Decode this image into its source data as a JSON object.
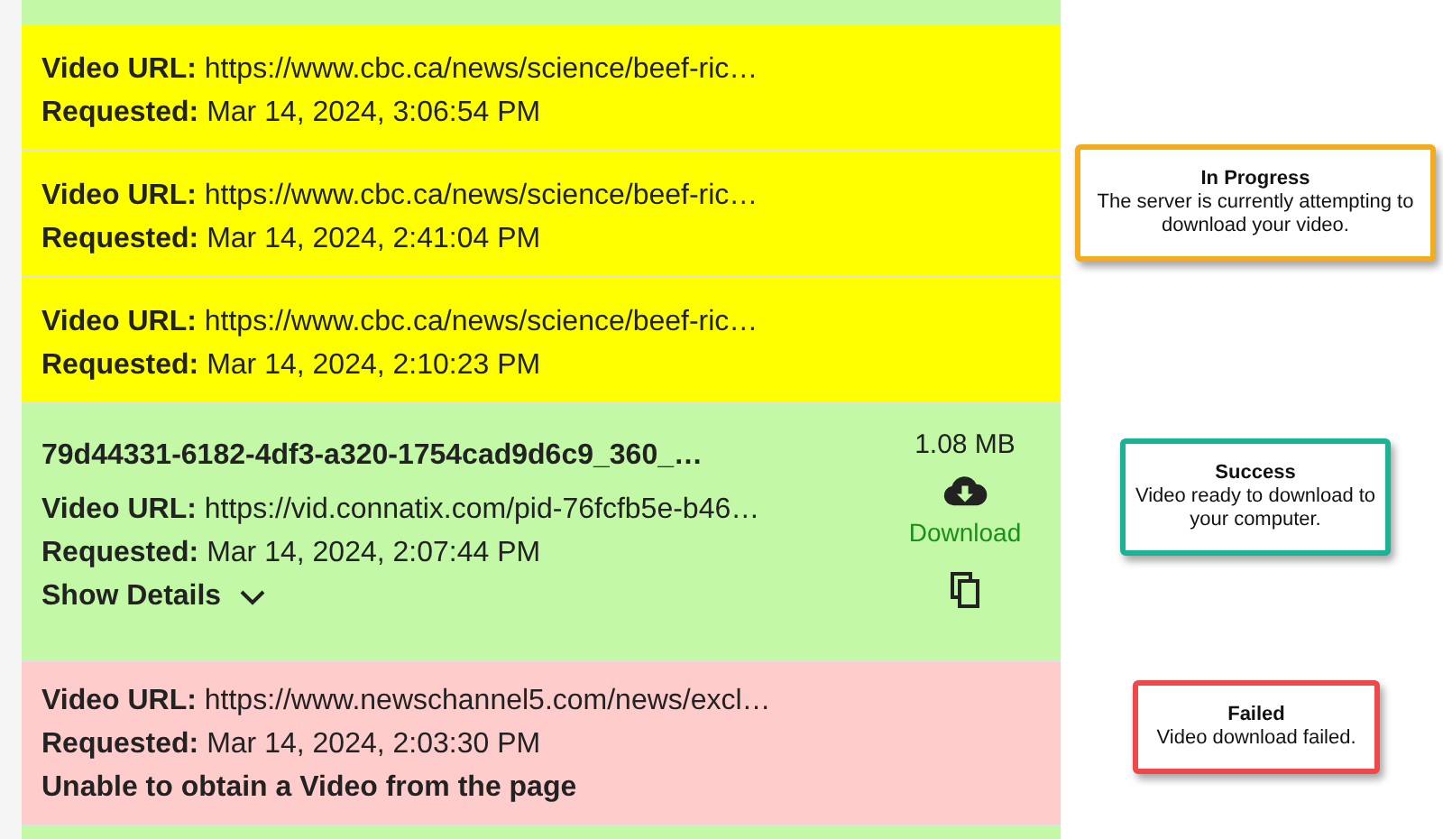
{
  "requests": [
    {
      "color": "#c3f9a6"
    },
    {
      "color": "#ffff00",
      "url_label": "Video URL:",
      "url": "https://www.cbc.ca/news/science/beef-ric…",
      "requested_label": "Requested:",
      "requested": "Mar 14, 2024, 3:06:54 PM"
    },
    {
      "color": "#ffff00",
      "url_label": "Video URL:",
      "url": "https://www.cbc.ca/news/science/beef-ric…",
      "requested_label": "Requested:",
      "requested": "Mar 14, 2024, 2:41:04 PM"
    },
    {
      "color": "#ffff00",
      "url_label": "Video URL:",
      "url": "https://www.cbc.ca/news/science/beef-ric…",
      "requested_label": "Requested:",
      "requested": "Mar 14, 2024, 2:10:23 PM"
    },
    {
      "color": "#c3f9a6",
      "filename": "79d44331-6182-4df3-a320-1754cad9d6c9_360_…",
      "url_label": "Video URL:",
      "url": "https://vid.connatix.com/pid-76fcfb5e-b46…",
      "requested_label": "Requested:",
      "requested": "Mar 14, 2024, 2:07:44 PM",
      "details_toggle": "Show Details",
      "expanded": false,
      "size": "1.08 MB",
      "download": "Download"
    },
    {
      "color": "#ffcccc",
      "url_label": "Video URL:",
      "url": "https://www.newschannel5.com/news/excl…",
      "requested_label": "Requested:",
      "requested": "Mar 14, 2024, 2:03:30 PM",
      "error": "Unable to obtain a Video from the page"
    },
    {
      "color": "#c3f9a6"
    }
  ],
  "legend": [
    {
      "color": "#f5ac1c",
      "title": "In Progress",
      "text": "The server is currently attempting to download your video."
    },
    {
      "color": "#1ab394",
      "title": "Success",
      "text": "Video ready to download to your computer."
    },
    {
      "color": "#f04848",
      "title": "Failed",
      "text": "Video download failed."
    }
  ]
}
